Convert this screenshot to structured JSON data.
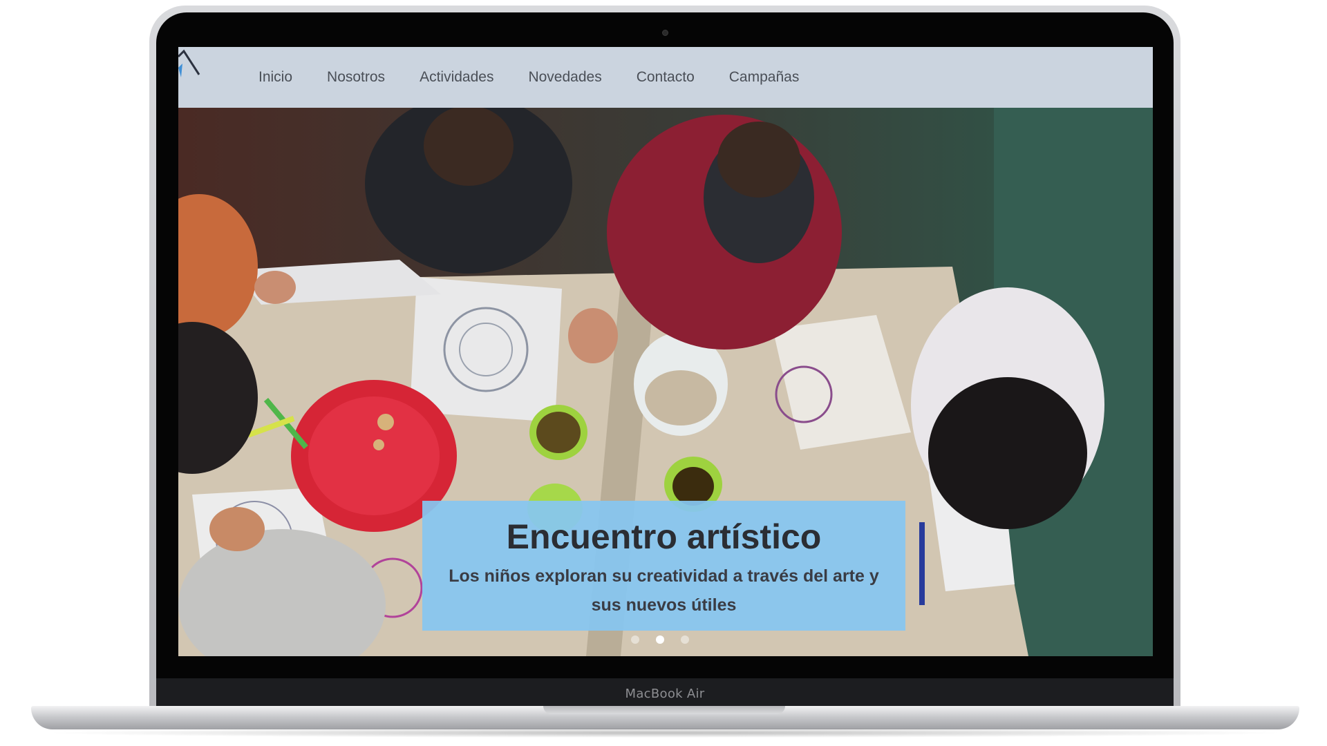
{
  "nav": {
    "items": [
      "Inicio",
      "Nosotros",
      "Actividades",
      "Novedades",
      "Contacto",
      "Campañas"
    ]
  },
  "hero": {
    "title": "Encuentro artístico",
    "text": "Los niños exploran su creatividad a través del arte y sus nuevos útiles",
    "slide_count": 3,
    "active_slide": 2
  },
  "device": {
    "label": "MacBook Air"
  },
  "colors": {
    "navbar_bg": "#cbd4df",
    "caption_bg": "#87c6f0",
    "nav_text": "#4a4f57"
  }
}
